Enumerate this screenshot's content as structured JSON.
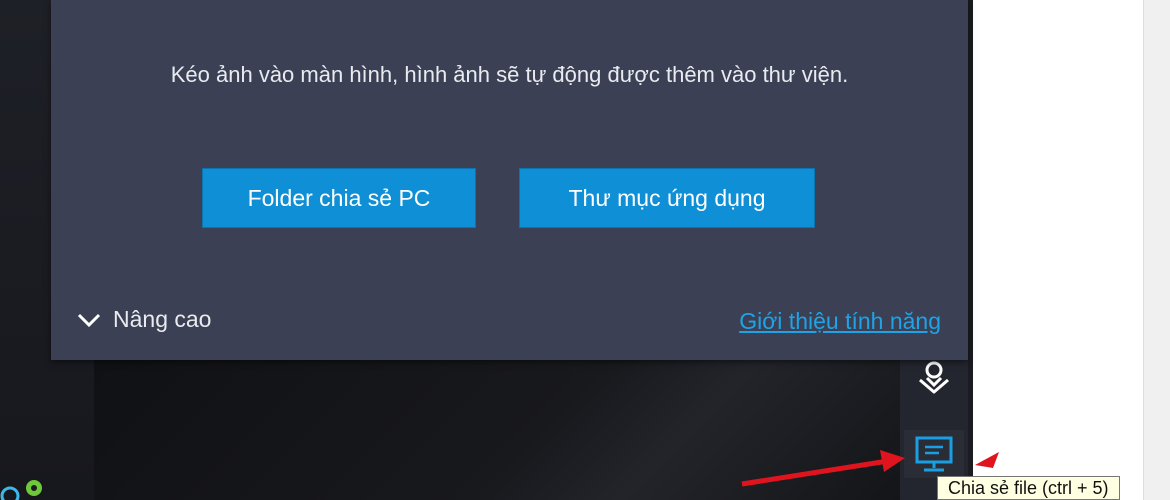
{
  "dialog": {
    "drop_hint": "Kéo ảnh vào màn hình, hình ảnh sẽ tự động được thêm vào thư viện.",
    "buttons": {
      "pc_shared_folder": "Folder chia sẻ PC",
      "app_folder": "Thư mục ứng dụng"
    },
    "advanced_label": "Nâng cao",
    "feature_intro_link": "Giới thiệu tính năng"
  },
  "sidebar": {
    "items": [
      {
        "icon": "location-pin-icon"
      },
      {
        "icon": "file-share-icon",
        "active": true
      }
    ]
  },
  "tooltip": {
    "text": "Chia sẻ file (ctrl + 5)"
  },
  "colors": {
    "dialog_bg": "#3b4054",
    "button_blue": "#0e8fd6",
    "link_blue": "#1fa3e6",
    "annotation_red": "#e0141e",
    "sidebar_bg": "#23262e"
  }
}
